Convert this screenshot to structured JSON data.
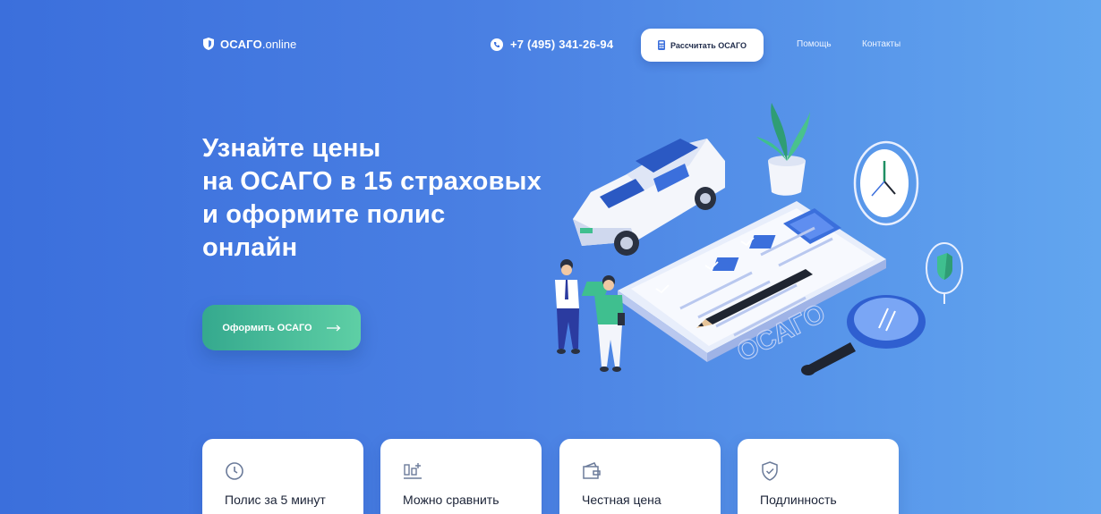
{
  "header": {
    "logo": {
      "brand": "ОСАГО",
      "tld": ".online",
      "icon": "shield-icon"
    },
    "phone": {
      "number": "+7 (495) 341-26-94",
      "icon": "phone-icon"
    },
    "calc_button": {
      "label": "Рассчитать ОСАГО",
      "icon": "calculator-icon"
    },
    "nav": [
      {
        "label": "Помощь"
      },
      {
        "label": "Контакты"
      }
    ]
  },
  "hero": {
    "title_lines": [
      "Узнайте цены",
      "на ОСАГО в 15 страховых",
      "и оформите полис",
      "онлайн"
    ],
    "cta": {
      "label": "Оформить ОСАГО",
      "icon": "arrow-right-icon"
    },
    "illustration": {
      "plate_text": "ОСАГО"
    }
  },
  "features": [
    {
      "title": "Полис за 5 минут",
      "icon": "clock-icon"
    },
    {
      "title": "Можно сравнить",
      "icon": "compare-icon"
    },
    {
      "title": "Честная цена",
      "icon": "wallet-icon"
    },
    {
      "title": "Подлинность",
      "icon": "shield-check-icon"
    }
  ],
  "colors": {
    "bg_start": "#3b6fdc",
    "bg_end": "#62a6ef",
    "accent_green": "#35a98e",
    "card_text": "#1b2337"
  }
}
